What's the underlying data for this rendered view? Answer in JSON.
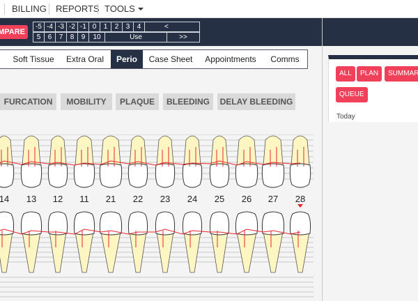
{
  "topnav": {
    "billing": "BILLING",
    "reports": "REPORTS",
    "tools": "TOOLS"
  },
  "compare_label": "COMPARE",
  "numgrid": {
    "row1": [
      "-5",
      "-4",
      "-3",
      "-2",
      "-1",
      "0",
      "1",
      "2",
      "3",
      "4",
      "<"
    ],
    "row2": [
      "5",
      "6",
      "7",
      "8",
      "9",
      "10",
      "Use",
      ">>"
    ]
  },
  "tabs": [
    {
      "label": "Soft Tissue",
      "active": false
    },
    {
      "label": "Extra Oral",
      "active": false
    },
    {
      "label": "Perio",
      "active": true
    },
    {
      "label": "Case Sheet",
      "active": false
    },
    {
      "label": "Appointments",
      "active": false
    },
    {
      "label": "Comms",
      "active": false
    }
  ],
  "filters": [
    "FURCATION",
    "MOBILITY",
    "PLAQUE",
    "BLEEDING",
    "DELAY BLEEDING"
  ],
  "tooth_numbers": [
    "14",
    "13",
    "12",
    "11",
    "21",
    "22",
    "23",
    "24",
    "25",
    "26",
    "27",
    "28"
  ],
  "selected_tooth": "28",
  "panel": {
    "buttons": [
      "ALL",
      "PLAN",
      "SUMMARY"
    ],
    "queue": "QUEUE",
    "today": "Today"
  },
  "colors": {
    "accent": "#f1405a",
    "navy": "#263044",
    "tooth_root": "#fdf6c3",
    "gum_line": "#e8242b"
  }
}
